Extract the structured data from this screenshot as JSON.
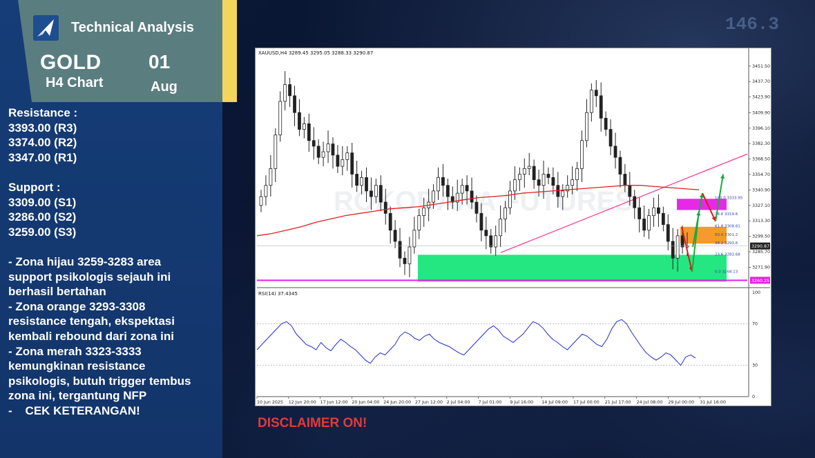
{
  "header": {
    "brand_title": "Technical Analysis",
    "asset": "GOLD",
    "timeframe": "H4 Chart",
    "day": "01",
    "month": "Aug"
  },
  "analysis_lines": [
    "Resistance :",
    "3393.00 (R3)",
    "3374.00 (R2)",
    "3347.00 (R1)",
    "",
    "Support :",
    "3309.00 (S1)",
    "3286.00 (S2)",
    "3259.00 (S3)",
    "",
    "- Zona hijau 3259-3283 area",
    "support psikologis sejauh ini",
    "berhasil bertahan",
    "- Zona orange 3293-3308",
    "resistance tengah, ekspektasi",
    "kembali rebound dari zona ini",
    "- Zona merah 3323-3333",
    "kemungkinan resistance",
    "psikologis, butuh trigger tembus",
    "zona ini, tergantung NFP",
    "-    CEK KETERANGAN!"
  ],
  "disclaimer": "DISCLAIMER ON!",
  "background_ticker": "146.3",
  "chart_data": {
    "type": "candlestick",
    "symbol_header": "XAUUSD,H4  3289.45 3295.05 3288.33 3290.87",
    "watermark": "ROKOBANA FUTURES",
    "price_ticks": [
      "3451.50",
      "3437.70",
      "3423.90",
      "3409.90",
      "3396.10",
      "3382.30",
      "3368.50",
      "3354.70",
      "3340.90",
      "3327.10",
      "3313.30",
      "3299.50",
      "3285.70",
      "3271.90"
    ],
    "price_ticks_values": [
      3451.5,
      3437.7,
      3423.9,
      3409.9,
      3396.1,
      3382.3,
      3368.5,
      3354.7,
      3340.9,
      3327.1,
      3313.3,
      3299.5,
      3285.7,
      3271.9
    ],
    "price_range": [
      3258,
      3460
    ],
    "current_price_label": "3290.87",
    "current_price": 3290.87,
    "low_line_label": "3260.25",
    "low_line": 3260.25,
    "date_labels": [
      "10 Jun 2025",
      "12 Jun 20:00",
      "17 Jun 12:00",
      "20 Jun 04:00",
      "24 Jun 20:00",
      "27 Jun 12:00",
      "2 Jul 04:00",
      "7 Jul 01:00",
      "9 Jul 16:00",
      "14 Jul 09:00",
      "17 Jul 00:00",
      "21 Jul 17:00",
      "24 Jul 08:00",
      "29 Jul 00:00",
      "31 Jul 16:00"
    ],
    "close_series": [
      3335,
      3345,
      3360,
      3390,
      3420,
      3435,
      3425,
      3410,
      3395,
      3400,
      3385,
      3380,
      3370,
      3375,
      3382,
      3372,
      3362,
      3368,
      3374,
      3355,
      3345,
      3352,
      3340,
      3335,
      3345,
      3330,
      3320,
      3305,
      3295,
      3280,
      3275,
      3290,
      3305,
      3318,
      3325,
      3330,
      3340,
      3352,
      3345,
      3335,
      3330,
      3338,
      3345,
      3340,
      3330,
      3320,
      3305,
      3300,
      3290,
      3300,
      3315,
      3325,
      3340,
      3350,
      3355,
      3360,
      3362,
      3350,
      3345,
      3355,
      3352,
      3345,
      3335,
      3340,
      3345,
      3350,
      3360,
      3385,
      3410,
      3430,
      3425,
      3405,
      3395,
      3380,
      3370,
      3355,
      3345,
      3335,
      3325,
      3315,
      3305,
      3318,
      3325,
      3320,
      3310,
      3295,
      3280,
      3300,
      3290,
      3291
    ],
    "ma_series": [
      3300,
      3302,
      3305,
      3308,
      3312,
      3315,
      3318,
      3320,
      3322,
      3324,
      3325,
      3326,
      3328,
      3330,
      3332,
      3334,
      3335,
      3336,
      3338,
      3339,
      3340,
      3341,
      3342,
      3343,
      3344,
      3345,
      3345,
      3344,
      3343,
      3342,
      3341
    ],
    "rsi_label": "RSI(14) 37.4345",
    "rsi_ticks": [
      "100",
      "70",
      "30",
      "0"
    ],
    "rsi_tick_values": [
      100,
      70,
      30,
      0
    ],
    "rsi_series": [
      45,
      50,
      55,
      60,
      65,
      70,
      72,
      68,
      60,
      55,
      50,
      48,
      45,
      52,
      47,
      44,
      50,
      55,
      52,
      48,
      45,
      40,
      35,
      32,
      38,
      42,
      40,
      45,
      50,
      58,
      62,
      60,
      56,
      54,
      58,
      60,
      55,
      52,
      50,
      48,
      45,
      42,
      40,
      45,
      50,
      55,
      60,
      65,
      68,
      64,
      58,
      55,
      52,
      56,
      60,
      66,
      72,
      70,
      66,
      60,
      55,
      52,
      48,
      45,
      50,
      55,
      60,
      58,
      54,
      50,
      48,
      55,
      65,
      72,
      74,
      70,
      62,
      55,
      48,
      42,
      38,
      35,
      38,
      42,
      40,
      35,
      30,
      38,
      40,
      37
    ],
    "zones": [
      {
        "name": "green-support-zone",
        "low": 3259,
        "high": 3283,
        "color": "#19e67a"
      },
      {
        "name": "orange-resistance-zone",
        "low": 3293,
        "high": 3308,
        "color": "#f5951f"
      },
      {
        "name": "magenta-resistance-zone",
        "low": 3323,
        "high": 3333,
        "color": "#e61ee6"
      }
    ],
    "fib_labels": [
      {
        "text": "100.0  3333.95",
        "value": 3333.95
      },
      {
        "text": "78.6  3319.6",
        "value": 3319.6
      },
      {
        "text": "61.8  3308.81",
        "value": 3308.81
      },
      {
        "text": "50.0  3301.2",
        "value": 3301.2
      },
      {
        "text": "38.2  3293.6",
        "value": 3293.6
      },
      {
        "text": "23.6  3283.68",
        "value": 3283.68
      },
      {
        "text": "0.0  3268.13",
        "value": 3268.13
      }
    ],
    "colors": {
      "ma": "#e01f1f",
      "trendline": "#ff2d8f",
      "rsi": "#1f2bd6",
      "up_arrow": "#1aa83a",
      "down_arrow": "#e01a1a",
      "candle": "#222222"
    }
  }
}
